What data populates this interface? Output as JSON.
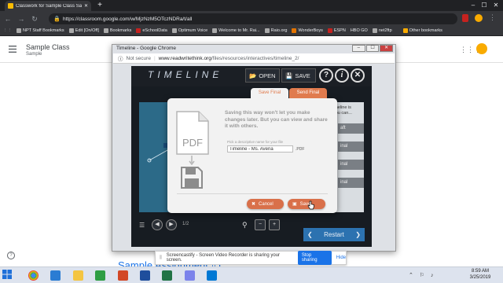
{
  "browser": {
    "tab_title": "Classwork for Sample Class Sam...",
    "url": "https://classroom.google.com/w/MjzNzM5OTczNDRa/t/all",
    "bookmarks": [
      "NPT Staff Bookmarks",
      "Edit [On/Off]",
      "Bookmarks",
      "eSchoolData",
      "Optimum Voice",
      "Welcome to Mr. Rai...",
      "Raio.org",
      "WonderBoys",
      "ESPN",
      "HBO GO",
      "net2ftp",
      "Other bookmarks"
    ]
  },
  "classroom": {
    "class_name": "Sample Class",
    "section": "Sample",
    "background_title": "Sample Assignment #1"
  },
  "popup": {
    "title": "Timeline - Google Chrome",
    "not_secure": "Not secure",
    "url_host": "www.readwritethink.org",
    "url_path": "/files/resources/interactives/timeline_2/"
  },
  "app": {
    "title": "TIMELINE",
    "open_label": "OPEN",
    "save_label": "SAVE",
    "help_label": "?",
    "info_label": "i",
    "right_hint": "imeline is\nyou can...",
    "right_buttons": [
      "aft",
      "inal",
      "inal",
      "inal"
    ],
    "page_indicator": "1/2",
    "restart_label": "Restart"
  },
  "dialog": {
    "tab_save_final": "Save Final",
    "tab_send_final": "Send Final",
    "message": "Saving this way won't let you make changes later. But you can view and share it with others.",
    "filename_label": "Pick a descriptive name for your file",
    "filename_value": "Timeline - Ms. Avena",
    "extension": ".PDF",
    "pdf_label": "PDF",
    "cancel_label": "Cancel",
    "save_label": "Save"
  },
  "sharing": {
    "message": "Screencastify - Screen Video Recorder is sharing your screen.",
    "stop_label": "Stop sharing",
    "hide_label": "Hide"
  },
  "taskbar": {
    "time": "8:59 AM",
    "date": "3/25/2019"
  },
  "colors": {
    "accent_orange": "#d9704a",
    "app_dark": "#171c22",
    "restart_blue": "#2c72b0",
    "stop_blue": "#1a73e8"
  }
}
